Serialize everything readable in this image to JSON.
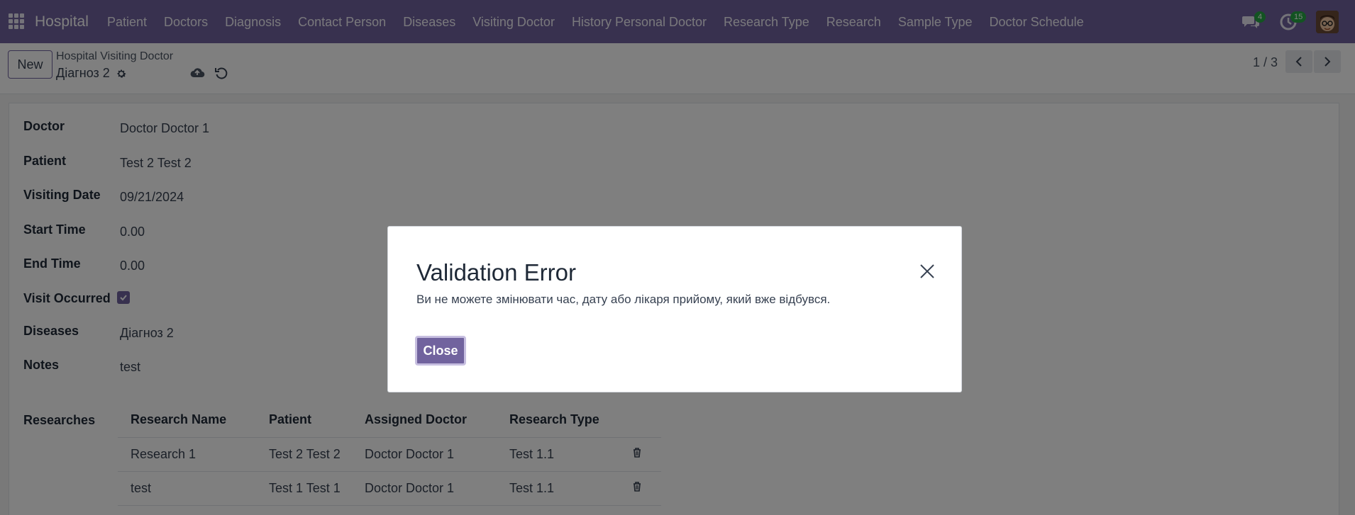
{
  "navbar": {
    "brand": "Hospital",
    "menu": [
      "Patient",
      "Doctors",
      "Diagnosis",
      "Contact Person",
      "Diseases",
      "Visiting Doctor",
      "History Personal Doctor",
      "Research Type",
      "Research",
      "Sample Type",
      "Doctor Schedule"
    ],
    "messages_count": "4",
    "activities_count": "15"
  },
  "control": {
    "new_label": "New",
    "breadcrumb": "Hospital Visiting Doctor",
    "record_name": "Діагноз 2",
    "pager": "1 / 3"
  },
  "form": {
    "fields": [
      {
        "label": "Doctor",
        "value": "Doctor Doctor 1"
      },
      {
        "label": "Patient",
        "value": "Test 2 Test 2"
      },
      {
        "label": "Visiting Date",
        "value": "09/21/2024"
      },
      {
        "label": "Start Time",
        "value": "0.00"
      },
      {
        "label": "End Time",
        "value": "0.00"
      },
      {
        "label": "Visit Occurred",
        "value": true
      },
      {
        "label": "Diseases",
        "value": "Діагноз 2"
      },
      {
        "label": "Notes",
        "value": "test"
      }
    ],
    "researches_label": "Researches",
    "researches_table": {
      "headers": [
        "Research Name",
        "Patient",
        "Assigned Doctor",
        "Research Type"
      ],
      "rows": [
        [
          "Research 1",
          "Test 2 Test 2",
          "Doctor Doctor 1",
          "Test 1.1"
        ],
        [
          "test",
          "Test 1 Test 1",
          "Doctor Doctor 1",
          "Test 1.1"
        ]
      ]
    }
  },
  "dialog": {
    "title": "Validation Error",
    "message": "Ви не можете змінювати час, дату або лікаря прийому, який вже відбувся.",
    "close_label": "Close"
  }
}
